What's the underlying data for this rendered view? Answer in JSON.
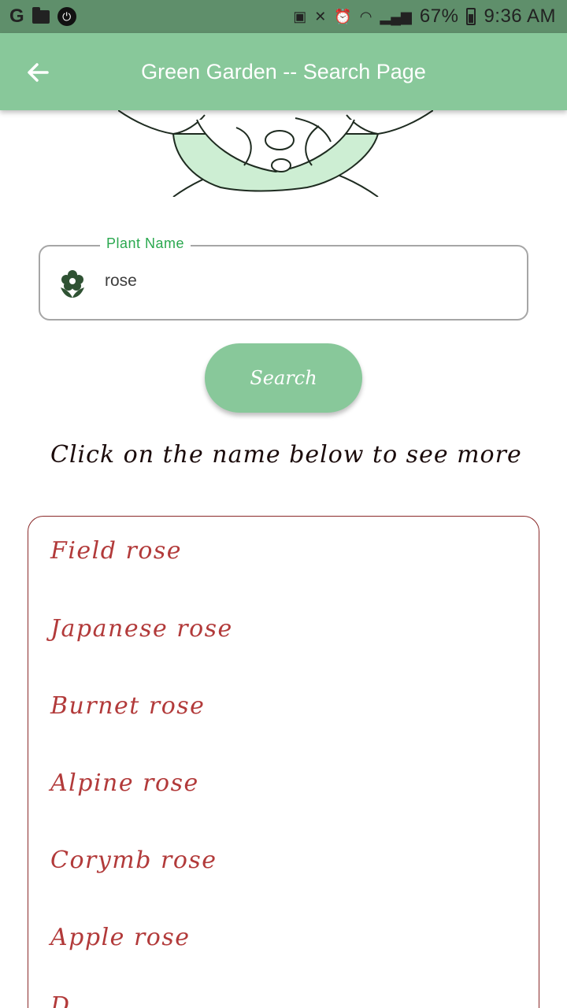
{
  "status_bar": {
    "left_letter": "G",
    "signal_percent": "67%",
    "time": "9:36 AM"
  },
  "app_bar": {
    "title": "Green Garden -- Search Page"
  },
  "search_form": {
    "label": "Plant Name",
    "value": "rose",
    "button_label": "Search"
  },
  "hint_text": "Click on the name below to see more",
  "results": [
    "Field rose",
    "Japanese rose",
    "Burnet rose",
    "Alpine rose",
    "Corymb rose",
    "Apple rose",
    "D"
  ],
  "colors": {
    "primary": "#88c89a",
    "status_bar": "#5f8f6b",
    "label_green": "#2aa84f",
    "result_text": "#b23a3a",
    "result_border": "#8a2a2a"
  }
}
